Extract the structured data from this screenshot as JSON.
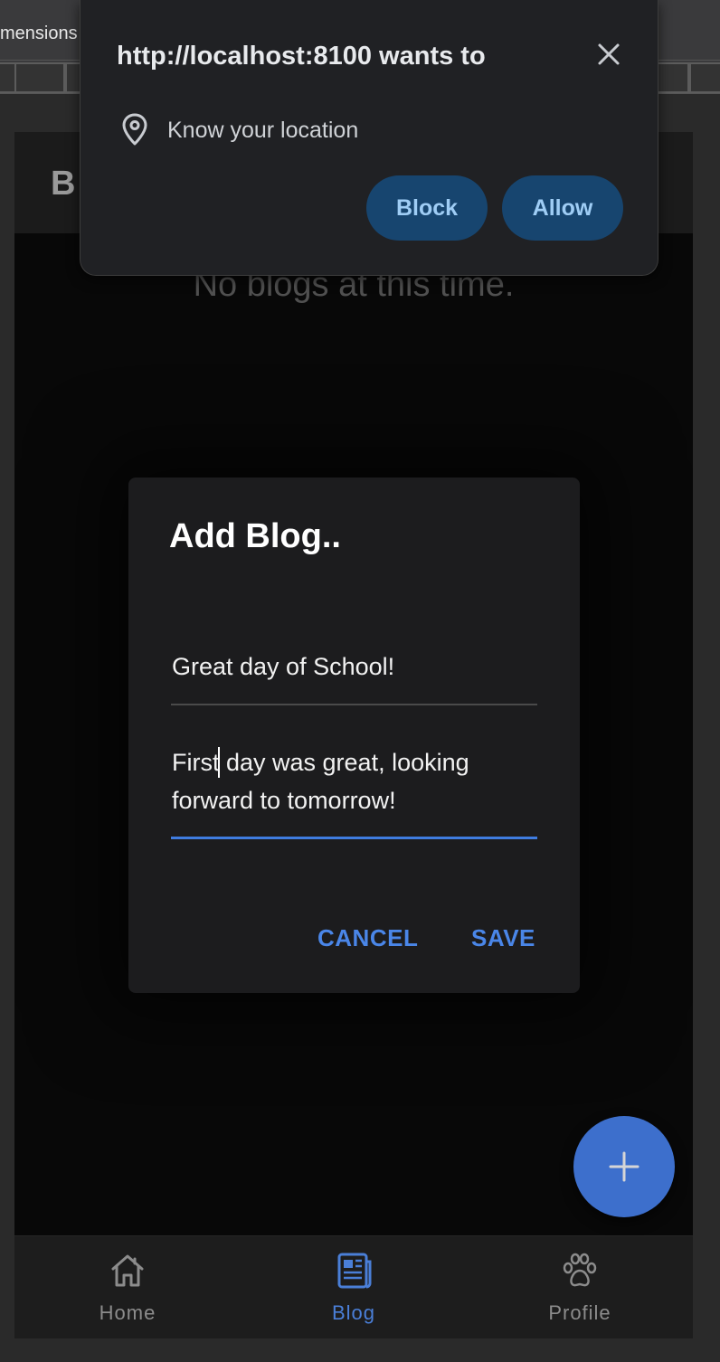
{
  "devtools": {
    "label": "mensions"
  },
  "app": {
    "header_title": "B",
    "empty_message": "No blogs at this time."
  },
  "dialog": {
    "title": "Add Blog..",
    "title_field_value": "Great day of School!",
    "body_field_value": "First day was great, looking forward to tomorrow!",
    "cancel_label": "CANCEL",
    "save_label": "SAVE"
  },
  "fab": {
    "icon": "plus-icon"
  },
  "tabs": [
    {
      "label": "Home",
      "icon": "home-icon",
      "active": false
    },
    {
      "label": "Blog",
      "icon": "newspaper-icon",
      "active": true
    },
    {
      "label": "Profile",
      "icon": "paw-icon",
      "active": false
    }
  ],
  "permission_prompt": {
    "title": "http://localhost:8100 wants to",
    "request": "Know your location",
    "block_label": "Block",
    "allow_label": "Allow"
  },
  "colors": {
    "accent": "#4a86e8",
    "fab": "#3d6fcc",
    "perm_button_bg": "#17456f",
    "perm_button_text": "#9fcdf5"
  }
}
